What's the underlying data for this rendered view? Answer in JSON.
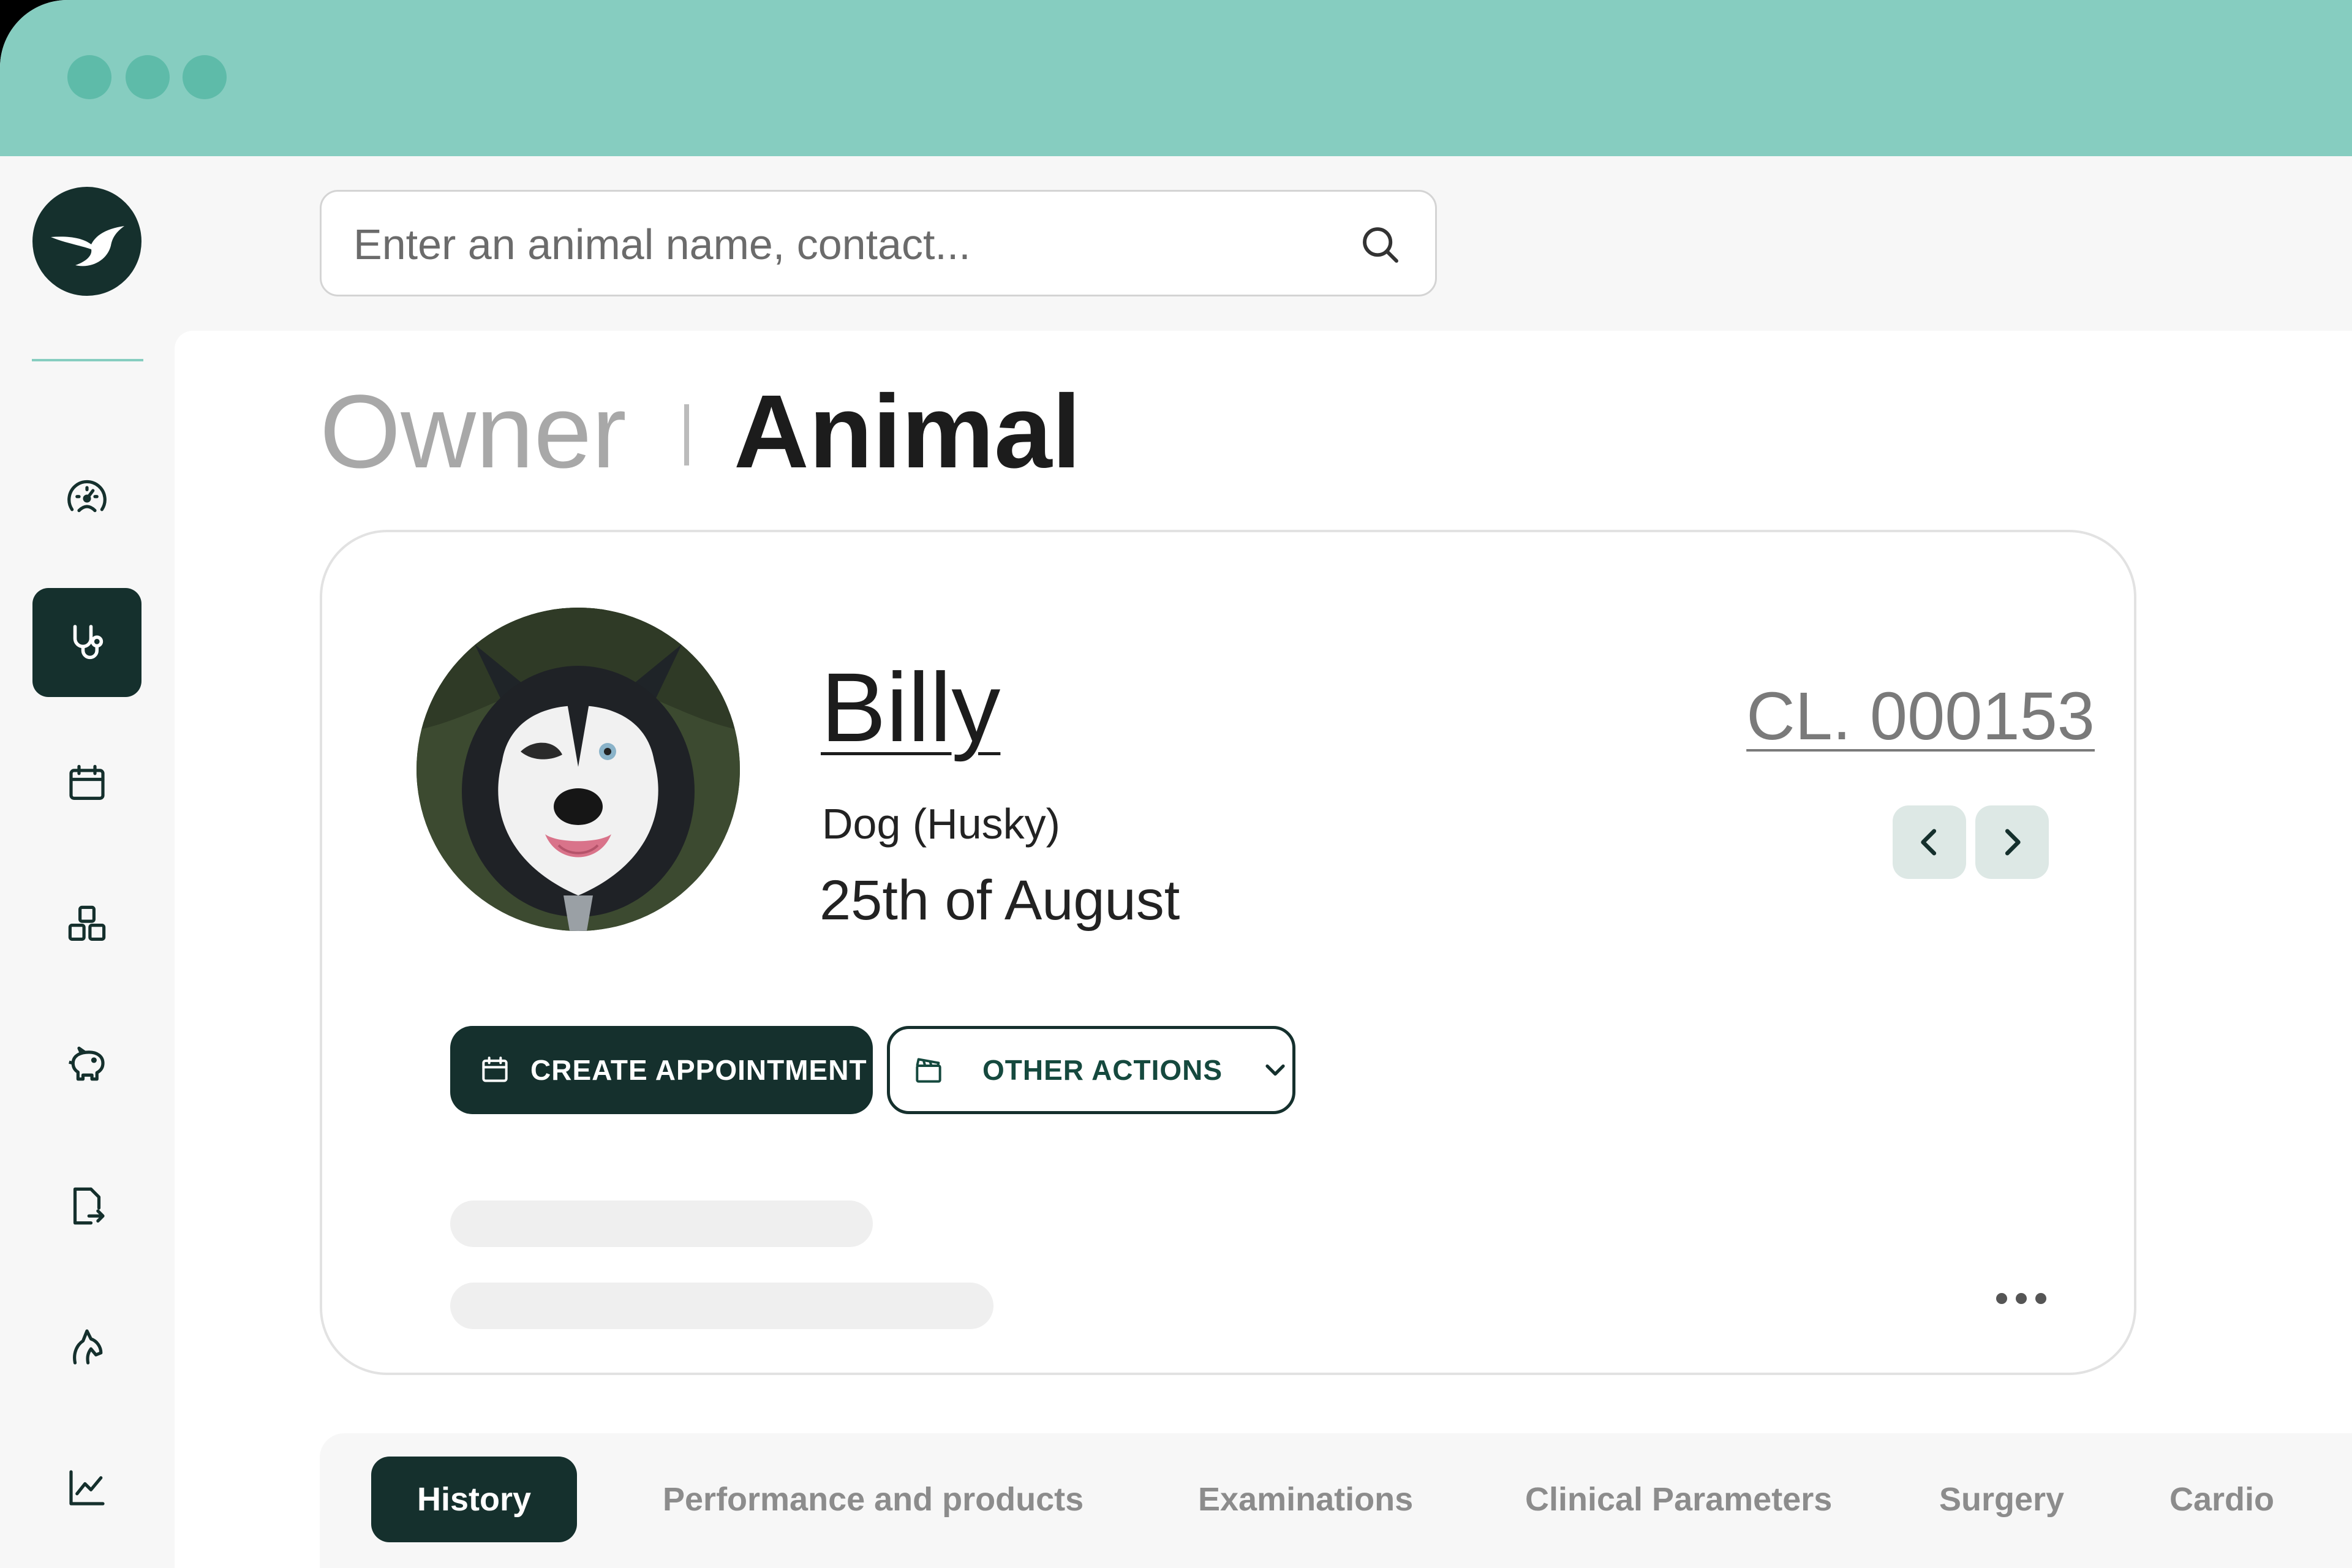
{
  "window": {
    "traffic_lights": [
      "dot",
      "dot",
      "dot"
    ]
  },
  "sidebar": {
    "logo_icon": "bird-logo-icon",
    "items": [
      {
        "name": "dashboard",
        "icon": "dashboard-gauge-icon",
        "active": false
      },
      {
        "name": "clinical",
        "icon": "stethoscope-icon",
        "active": true
      },
      {
        "name": "calendar",
        "icon": "calendar-icon",
        "active": false
      },
      {
        "name": "inventory",
        "icon": "boxes-icon",
        "active": false
      },
      {
        "name": "finance",
        "icon": "piggy-bank-icon",
        "active": false
      },
      {
        "name": "documents",
        "icon": "document-export-icon",
        "active": false
      },
      {
        "name": "animals",
        "icon": "horse-head-icon",
        "active": false
      },
      {
        "name": "statistics",
        "icon": "line-chart-icon",
        "active": false
      }
    ]
  },
  "search": {
    "placeholder": "Enter an animal name, contact...",
    "value": ""
  },
  "breadcrumb": {
    "owner": "Owner",
    "animal": "Animal"
  },
  "animal": {
    "name": "Billy",
    "species": "Dog (Husky)",
    "date": "25th of August",
    "client_code": "CL. 000153"
  },
  "actions": {
    "create_appointment": "CREATE APPOINTMENT",
    "other_actions": "OTHER ACTIONS"
  },
  "tabs": [
    {
      "label": "History",
      "active": true
    },
    {
      "label": "Performance and products",
      "active": false
    },
    {
      "label": "Examinations",
      "active": false
    },
    {
      "label": "Clinical Parameters",
      "active": false
    },
    {
      "label": "Surgery",
      "active": false
    },
    {
      "label": "Cardio",
      "active": false
    }
  ],
  "colors": {
    "titlebar": "#86cdc0",
    "accent_dark": "#15302d",
    "pager_bg": "#dde8e5"
  }
}
